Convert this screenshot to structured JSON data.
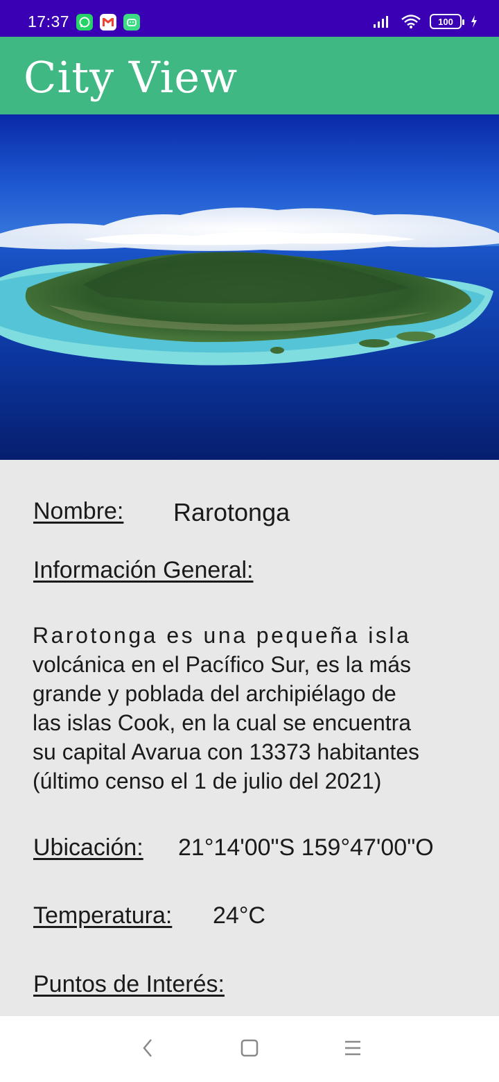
{
  "status_bar": {
    "time": "17:37",
    "notifications": [
      "whatsapp-icon",
      "gmail-icon",
      "android-icon"
    ],
    "battery": "100"
  },
  "app": {
    "title": "City View"
  },
  "city": {
    "name_label": "Nombre:",
    "name": "Rarotonga",
    "info_label": "Información General:",
    "info_lines": [
      "Rarotonga es una pequeña isla",
      "volcánica en el Pacífico Sur, es la más",
      "grande y poblada del archipiélago de",
      "las islas Cook, en la cual se encuentra",
      "su capital Avarua con 13373 habitantes",
      "(último censo el 1 de julio del 2021)"
    ],
    "location_label": "Ubicación:",
    "location": "21°14'00\"S 159°47'00\"O",
    "temperature_label": "Temperatura:",
    "temperature": "24°C",
    "poi_label": "Puntos de Interés:"
  },
  "colors": {
    "status_bar": "#3a00b3",
    "app_bar": "#40b884",
    "background": "#e8e8e8"
  },
  "nav_bar": {
    "buttons": [
      "back-icon",
      "home-icon",
      "menu-icon"
    ]
  }
}
